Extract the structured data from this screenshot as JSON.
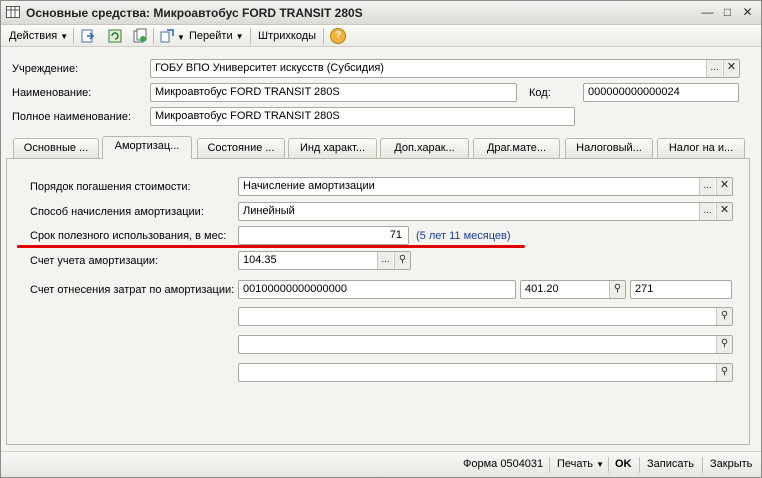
{
  "window": {
    "title": "Основные средства: Микроавтобус FORD TRANSIT 280S"
  },
  "toolbar": {
    "actions_label": "Действия",
    "goto_label": "Перейти",
    "barcodes_label": "Штрихкоды",
    "help_label": "?"
  },
  "header": {
    "institution_label": "Учреждение:",
    "institution_value": "ГОБУ ВПО Университет искусств (Субсидия)",
    "name_label": "Наименование:",
    "name_value": "Микроавтобус FORD TRANSIT 280S",
    "code_label": "Код:",
    "code_value": "000000000000024",
    "fullname_label": "Полное наименование:",
    "fullname_value": "Микроавтобус FORD TRANSIT 280S"
  },
  "tabs": [
    {
      "label": "Основные ..."
    },
    {
      "label": "Амортизац..."
    },
    {
      "label": "Состояние ..."
    },
    {
      "label": "Инд характ..."
    },
    {
      "label": "Доп.харак..."
    },
    {
      "label": "Драг.мате..."
    },
    {
      "label": "Налоговый..."
    },
    {
      "label": "Налог на и..."
    }
  ],
  "depreciation": {
    "order_label": "Порядок погашения стоимости:",
    "order_value": "Начисление амортизации",
    "method_label": "Способ начисления амортизации:",
    "method_value": "Линейный",
    "life_label": "Срок полезного использования, в мес:",
    "life_value": "71",
    "life_hint": "(5 лет 11 месяцев)",
    "account_label": "Счет учета амортизации:",
    "account_value": "104.35",
    "cost_label": "Счет отнесения затрат по амортизации:",
    "cost_value": "00100000000000000",
    "cost_account": "401.20",
    "cost_code": "271"
  },
  "footer": {
    "form_label": "Форма 0504031",
    "print_label": "Печать",
    "ok_label": "OK",
    "save_label": "Записать",
    "close_label": "Закрыть"
  }
}
